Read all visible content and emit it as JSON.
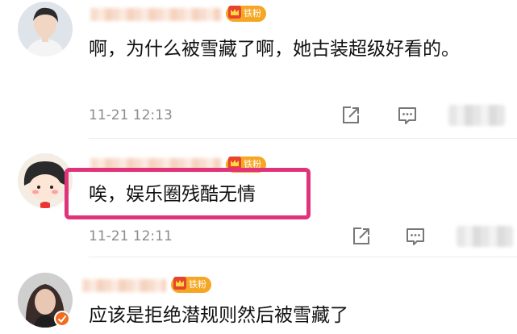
{
  "comments": [
    {
      "text": "啊，为什么被雪藏了啊，她古装超级好看的。",
      "time": "11-21 12:13",
      "badge": "铁粉",
      "avatar_icon": "male-portrait-avatar",
      "highlighted": false
    },
    {
      "text": "唉，娱乐圈残酷无情",
      "time": "11-21 12:11",
      "badge": "铁粉",
      "avatar_icon": "cartoon-girl-avatar",
      "highlighted": true
    },
    {
      "text": "应该是拒绝潜规则然后被雪藏了",
      "time": "",
      "badge": "铁粉",
      "avatar_icon": "female-portrait-avatar",
      "highlighted": false
    }
  ],
  "icons": {
    "share": "share-icon",
    "reply": "comment-icon"
  },
  "colors": {
    "badge": "#f5a623",
    "highlight": "#e0337a",
    "time": "#8c8c8c"
  }
}
